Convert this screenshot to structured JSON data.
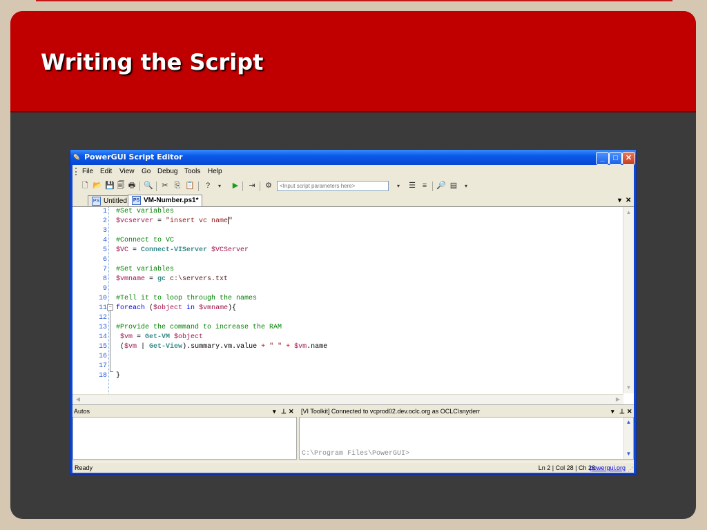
{
  "slide": {
    "title": "Writing the Script"
  },
  "window": {
    "title": "PowerGUI Script Editor",
    "controls": {
      "minimize": "_",
      "maximize": "□",
      "close": "✕"
    }
  },
  "menu": [
    "File",
    "Edit",
    "View",
    "Go",
    "Debug",
    "Tools",
    "Help"
  ],
  "toolbar": {
    "params_placeholder": "<Input script parameters here>"
  },
  "tabs": [
    {
      "label": "Untitled",
      "active": false
    },
    {
      "label": "VM-Number.ps1*",
      "active": true
    }
  ],
  "editor": {
    "line_numbers": [
      "1",
      "2",
      "3",
      "4",
      "5",
      "6",
      "7",
      "8",
      "9",
      "10",
      "11",
      "12",
      "13",
      "14",
      "15",
      "16",
      "17",
      "18"
    ],
    "lines": {
      "l1": "#Set variables",
      "l2a": "$vcserver",
      "l2b": " = ",
      "l2c": "\"insert vc name",
      "l2d": "\"",
      "l4": "#Connect to VC",
      "l5a": "$VC",
      "l5b": " = ",
      "l5c": "Connect-VIServer",
      "l5d": " $VCServer",
      "l7": "#Set variables",
      "l8a": "$vmname",
      "l8b": " = ",
      "l8c": "gc",
      "l8d": " c:\\servers.txt",
      "l10": "#Tell it to loop through the names",
      "l11a": "foreach",
      "l11b": " (",
      "l11c": "$object",
      "l11d": " in ",
      "l11e": "$vmname",
      "l11f": "){",
      "l13": "#Provide the command to increase the RAM",
      "l14a": " $vm",
      "l14b": " = ",
      "l14c": "Get-VM",
      "l14d": " $object",
      "l15a": " (",
      "l15b": "$vm",
      "l15c": " | ",
      "l15d": "Get-View",
      "l15e": ").summary.vm.value ",
      "l15f": "+",
      "l15g": " \" \" ",
      "l15h": "+",
      "l15i": " $vm",
      "l15j": ".name",
      "l18": "}"
    }
  },
  "autos_pane": {
    "title": "Autos"
  },
  "console_pane": {
    "title": "[VI Toolkit] Connected to vcprod02.dev.oclc.org as OCLC\\snyderr",
    "prompt": "C:\\Program Files\\PowerGUI>"
  },
  "status": {
    "left": "Ready",
    "position": "Ln 2 | Col 28 | Ch 28",
    "link": "powergui.org"
  },
  "colors": {
    "banner_red": "#c00000",
    "titlebar_blue": "#0a5ae8",
    "comment_green": "#008000",
    "variable": "#a0154e",
    "cmdlet": "#3a8c8c",
    "keyword": "#0000ff"
  }
}
